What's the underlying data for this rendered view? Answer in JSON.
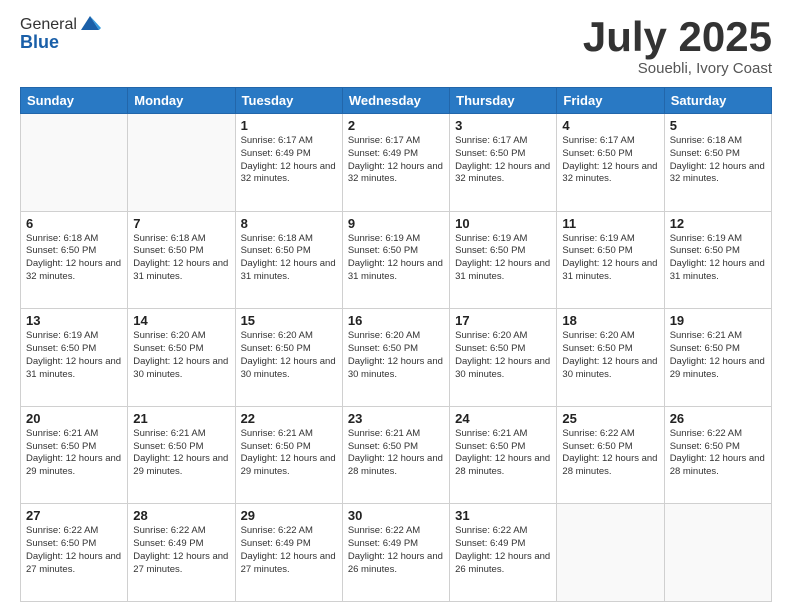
{
  "header": {
    "logo_general": "General",
    "logo_blue": "Blue",
    "month": "July 2025",
    "location": "Souebli, Ivory Coast"
  },
  "days_of_week": [
    "Sunday",
    "Monday",
    "Tuesday",
    "Wednesday",
    "Thursday",
    "Friday",
    "Saturday"
  ],
  "weeks": [
    [
      {
        "day": "",
        "info": ""
      },
      {
        "day": "",
        "info": ""
      },
      {
        "day": "1",
        "info": "Sunrise: 6:17 AM\nSunset: 6:49 PM\nDaylight: 12 hours and 32 minutes."
      },
      {
        "day": "2",
        "info": "Sunrise: 6:17 AM\nSunset: 6:49 PM\nDaylight: 12 hours and 32 minutes."
      },
      {
        "day": "3",
        "info": "Sunrise: 6:17 AM\nSunset: 6:50 PM\nDaylight: 12 hours and 32 minutes."
      },
      {
        "day": "4",
        "info": "Sunrise: 6:17 AM\nSunset: 6:50 PM\nDaylight: 12 hours and 32 minutes."
      },
      {
        "day": "5",
        "info": "Sunrise: 6:18 AM\nSunset: 6:50 PM\nDaylight: 12 hours and 32 minutes."
      }
    ],
    [
      {
        "day": "6",
        "info": "Sunrise: 6:18 AM\nSunset: 6:50 PM\nDaylight: 12 hours and 32 minutes."
      },
      {
        "day": "7",
        "info": "Sunrise: 6:18 AM\nSunset: 6:50 PM\nDaylight: 12 hours and 31 minutes."
      },
      {
        "day": "8",
        "info": "Sunrise: 6:18 AM\nSunset: 6:50 PM\nDaylight: 12 hours and 31 minutes."
      },
      {
        "day": "9",
        "info": "Sunrise: 6:19 AM\nSunset: 6:50 PM\nDaylight: 12 hours and 31 minutes."
      },
      {
        "day": "10",
        "info": "Sunrise: 6:19 AM\nSunset: 6:50 PM\nDaylight: 12 hours and 31 minutes."
      },
      {
        "day": "11",
        "info": "Sunrise: 6:19 AM\nSunset: 6:50 PM\nDaylight: 12 hours and 31 minutes."
      },
      {
        "day": "12",
        "info": "Sunrise: 6:19 AM\nSunset: 6:50 PM\nDaylight: 12 hours and 31 minutes."
      }
    ],
    [
      {
        "day": "13",
        "info": "Sunrise: 6:19 AM\nSunset: 6:50 PM\nDaylight: 12 hours and 31 minutes."
      },
      {
        "day": "14",
        "info": "Sunrise: 6:20 AM\nSunset: 6:50 PM\nDaylight: 12 hours and 30 minutes."
      },
      {
        "day": "15",
        "info": "Sunrise: 6:20 AM\nSunset: 6:50 PM\nDaylight: 12 hours and 30 minutes."
      },
      {
        "day": "16",
        "info": "Sunrise: 6:20 AM\nSunset: 6:50 PM\nDaylight: 12 hours and 30 minutes."
      },
      {
        "day": "17",
        "info": "Sunrise: 6:20 AM\nSunset: 6:50 PM\nDaylight: 12 hours and 30 minutes."
      },
      {
        "day": "18",
        "info": "Sunrise: 6:20 AM\nSunset: 6:50 PM\nDaylight: 12 hours and 30 minutes."
      },
      {
        "day": "19",
        "info": "Sunrise: 6:21 AM\nSunset: 6:50 PM\nDaylight: 12 hours and 29 minutes."
      }
    ],
    [
      {
        "day": "20",
        "info": "Sunrise: 6:21 AM\nSunset: 6:50 PM\nDaylight: 12 hours and 29 minutes."
      },
      {
        "day": "21",
        "info": "Sunrise: 6:21 AM\nSunset: 6:50 PM\nDaylight: 12 hours and 29 minutes."
      },
      {
        "day": "22",
        "info": "Sunrise: 6:21 AM\nSunset: 6:50 PM\nDaylight: 12 hours and 29 minutes."
      },
      {
        "day": "23",
        "info": "Sunrise: 6:21 AM\nSunset: 6:50 PM\nDaylight: 12 hours and 28 minutes."
      },
      {
        "day": "24",
        "info": "Sunrise: 6:21 AM\nSunset: 6:50 PM\nDaylight: 12 hours and 28 minutes."
      },
      {
        "day": "25",
        "info": "Sunrise: 6:22 AM\nSunset: 6:50 PM\nDaylight: 12 hours and 28 minutes."
      },
      {
        "day": "26",
        "info": "Sunrise: 6:22 AM\nSunset: 6:50 PM\nDaylight: 12 hours and 28 minutes."
      }
    ],
    [
      {
        "day": "27",
        "info": "Sunrise: 6:22 AM\nSunset: 6:50 PM\nDaylight: 12 hours and 27 minutes."
      },
      {
        "day": "28",
        "info": "Sunrise: 6:22 AM\nSunset: 6:49 PM\nDaylight: 12 hours and 27 minutes."
      },
      {
        "day": "29",
        "info": "Sunrise: 6:22 AM\nSunset: 6:49 PM\nDaylight: 12 hours and 27 minutes."
      },
      {
        "day": "30",
        "info": "Sunrise: 6:22 AM\nSunset: 6:49 PM\nDaylight: 12 hours and 26 minutes."
      },
      {
        "day": "31",
        "info": "Sunrise: 6:22 AM\nSunset: 6:49 PM\nDaylight: 12 hours and 26 minutes."
      },
      {
        "day": "",
        "info": ""
      },
      {
        "day": "",
        "info": ""
      }
    ]
  ]
}
